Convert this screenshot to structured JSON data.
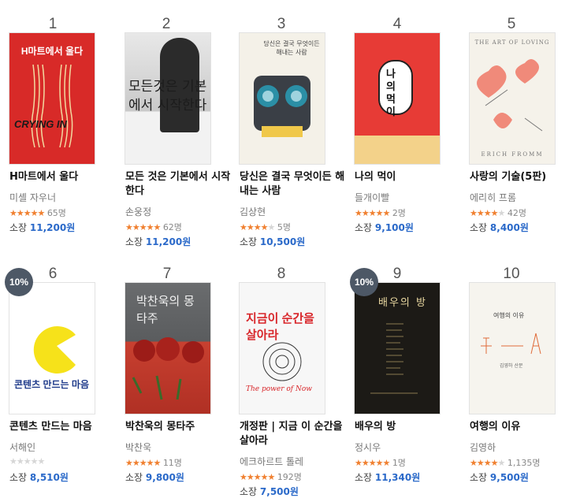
{
  "items": [
    {
      "rank": "1",
      "title": "H마트에서 울다",
      "author": "미셸 자우너",
      "stars": 5,
      "reviews": "65명",
      "price_label": "소장",
      "price": "11,200원",
      "cover_color": "#d82a28",
      "cover_text": "H마트에서 울다",
      "cover_sub": "CRYING IN"
    },
    {
      "rank": "2",
      "title": "모든 것은 기본에서 시작한다",
      "author": "손웅정",
      "stars": 5,
      "reviews": "62명",
      "price_label": "소장",
      "price": "11,200원",
      "cover_color": "#f0f0f0",
      "cover_text": "모든것은 기본에서 시작한다"
    },
    {
      "rank": "3",
      "title": "당신은 결국 무엇이든 해내는 사람",
      "author": "김상현",
      "stars": 4,
      "reviews": "5명",
      "price_label": "소장",
      "price": "10,500원",
      "cover_color": "#f4f1e8",
      "cover_text": "당신은 결국 무엇이든 해내는 사람"
    },
    {
      "rank": "4",
      "title": "나의 먹이",
      "author": "들개이빨",
      "stars": 5,
      "reviews": "2명",
      "price_label": "소장",
      "price": "9,100원",
      "cover_color": "#e73b36",
      "cover_text": "나의 먹이"
    },
    {
      "rank": "5",
      "title": "사랑의 기술(5판)",
      "author": "에리히 프롬",
      "stars": 4,
      "reviews": "42명",
      "price_label": "소장",
      "price": "8,400원",
      "cover_color": "#f5f2ea",
      "cover_text": "THE ART OF LOVING",
      "cover_sub": "ERICH FROMM"
    },
    {
      "rank": "6",
      "title": "콘텐츠 만드는 마음",
      "author": "서해인",
      "stars": 0,
      "reviews": "",
      "price_label": "소장",
      "price": "8,510원",
      "badge": "10%",
      "cover_color": "#ffffff",
      "cover_text": "콘텐츠 만드는 마음"
    },
    {
      "rank": "7",
      "title": "박찬욱의 몽타주",
      "author": "박찬욱",
      "stars": 5,
      "reviews": "11명",
      "price_label": "소장",
      "price": "9,800원",
      "cover_color": "#5a5c5e",
      "cover_text": "박찬욱의 몽타주"
    },
    {
      "rank": "8",
      "title": "개정판 | 지금 이 순간을 살아라",
      "author": "에크하르트 톨레",
      "stars": 5,
      "reviews": "192명",
      "price_label": "소장",
      "price": "7,500원",
      "cover_color": "#f7f7f7",
      "cover_text": "지금이 순간을 살아라",
      "cover_sub": "The power of Now"
    },
    {
      "rank": "9",
      "title": "배우의 방",
      "author": "정시우",
      "stars": 5,
      "reviews": "1명",
      "price_label": "소장",
      "price": "11,340원",
      "badge": "10%",
      "cover_color": "#1c1a16",
      "cover_text": "배우의 방"
    },
    {
      "rank": "10",
      "title": "여행의 이유",
      "author": "김영하",
      "stars": 4,
      "reviews": "1,135명",
      "price_label": "소장",
      "price": "9,500원",
      "cover_color": "#f6f4ee",
      "cover_text": "여행의 이유",
      "cover_sub": "김영하 산문"
    }
  ]
}
